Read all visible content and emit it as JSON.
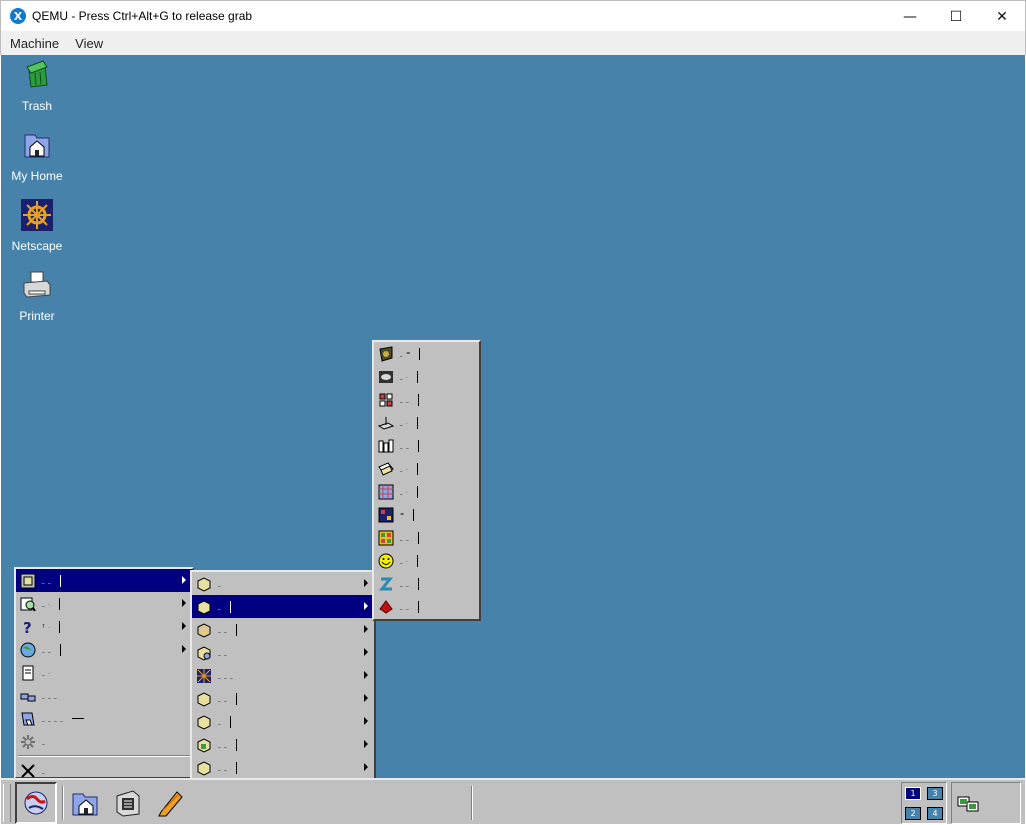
{
  "window": {
    "title": "QEMU - Press Ctrl+Alt+G to release grab",
    "minimize_glyph": "—",
    "maximize_glyph": "☐",
    "close_glyph": "✕"
  },
  "menubar": [
    "Machine",
    "View"
  ],
  "desktop_icons": [
    {
      "label": "Trash",
      "icon": "trash-icon"
    },
    {
      "label": "My Home",
      "icon": "home-folder-icon"
    },
    {
      "label": "Netscape",
      "icon": "netscape-wheel-icon"
    },
    {
      "label": "Printer",
      "icon": "printer-icon"
    }
  ],
  "start_menu": {
    "items": [
      {
        "label": "_ _",
        "icon": "applications-box-icon",
        "submenu": true,
        "selected": true
      },
      {
        "label": "_ .",
        "icon": "search-icon",
        "submenu": true
      },
      {
        "label": "? .",
        "icon": "help-icon",
        "submenu": true
      },
      {
        "label": "_ _",
        "icon": "globe-icon",
        "submenu": true
      },
      {
        "label": "_ .",
        "icon": "document-icon",
        "submenu": false
      },
      {
        "label": "_ _ _",
        "icon": "network-icon",
        "submenu": false
      },
      {
        "label": "_ _ _ _",
        "icon": "run-icon",
        "submenu": false
      },
      {
        "label": "_",
        "icon": "settings-icon",
        "submenu": false
      },
      {
        "label": "_",
        "icon": "logout-icon",
        "submenu": false
      }
    ]
  },
  "submenu_1": {
    "items": [
      {
        "label": "_",
        "icon": "box-icon"
      },
      {
        "label": "_",
        "icon": "box-icon",
        "selected": true
      },
      {
        "label": "_ _",
        "icon": "box-icon"
      },
      {
        "label": "_ _",
        "icon": "box-icon"
      },
      {
        "label": "_ _ _",
        "icon": "grid-icon"
      },
      {
        "label": "_ _",
        "icon": "box-icon"
      },
      {
        "label": "_",
        "icon": "box-icon"
      },
      {
        "label": "_ _",
        "icon": "box-icon"
      },
      {
        "label": "_ _",
        "icon": "box-icon"
      },
      {
        "label": "_ _",
        "icon": "pdf-icon"
      }
    ]
  },
  "submenu_2": {
    "items": [
      {
        "label": "_ =",
        "icon": "shield-icon"
      },
      {
        "label": "_ .",
        "icon": "photo-icon"
      },
      {
        "label": "_ _",
        "icon": "puzzle-icon"
      },
      {
        "label": "_ .",
        "icon": "drawing-icon"
      },
      {
        "label": "_ _",
        "icon": "blocks-icon"
      },
      {
        "label": "_ .",
        "icon": "cards-icon"
      },
      {
        "label": "_ .",
        "icon": "mine-grid-icon"
      },
      {
        "label": "=",
        "icon": "game-grid-icon"
      },
      {
        "label": "_ _",
        "icon": "tile-game-icon"
      },
      {
        "label": "_ .",
        "icon": "smiley-icon"
      },
      {
        "label": "_ _",
        "icon": "snake-icon"
      },
      {
        "label": "_ _",
        "icon": "shape-icon"
      }
    ]
  },
  "taskbar": {
    "launchers": [
      "globe-start-icon",
      "home-launcher-icon",
      "terminal-launcher-icon",
      "pencil-launcher-icon"
    ],
    "pager": [
      "1",
      "3",
      "2",
      "4"
    ],
    "active_desktop": "1"
  },
  "colors": {
    "desktop": "#4682aa",
    "menu_bg": "#c0c0c0",
    "selection": "#000080"
  }
}
